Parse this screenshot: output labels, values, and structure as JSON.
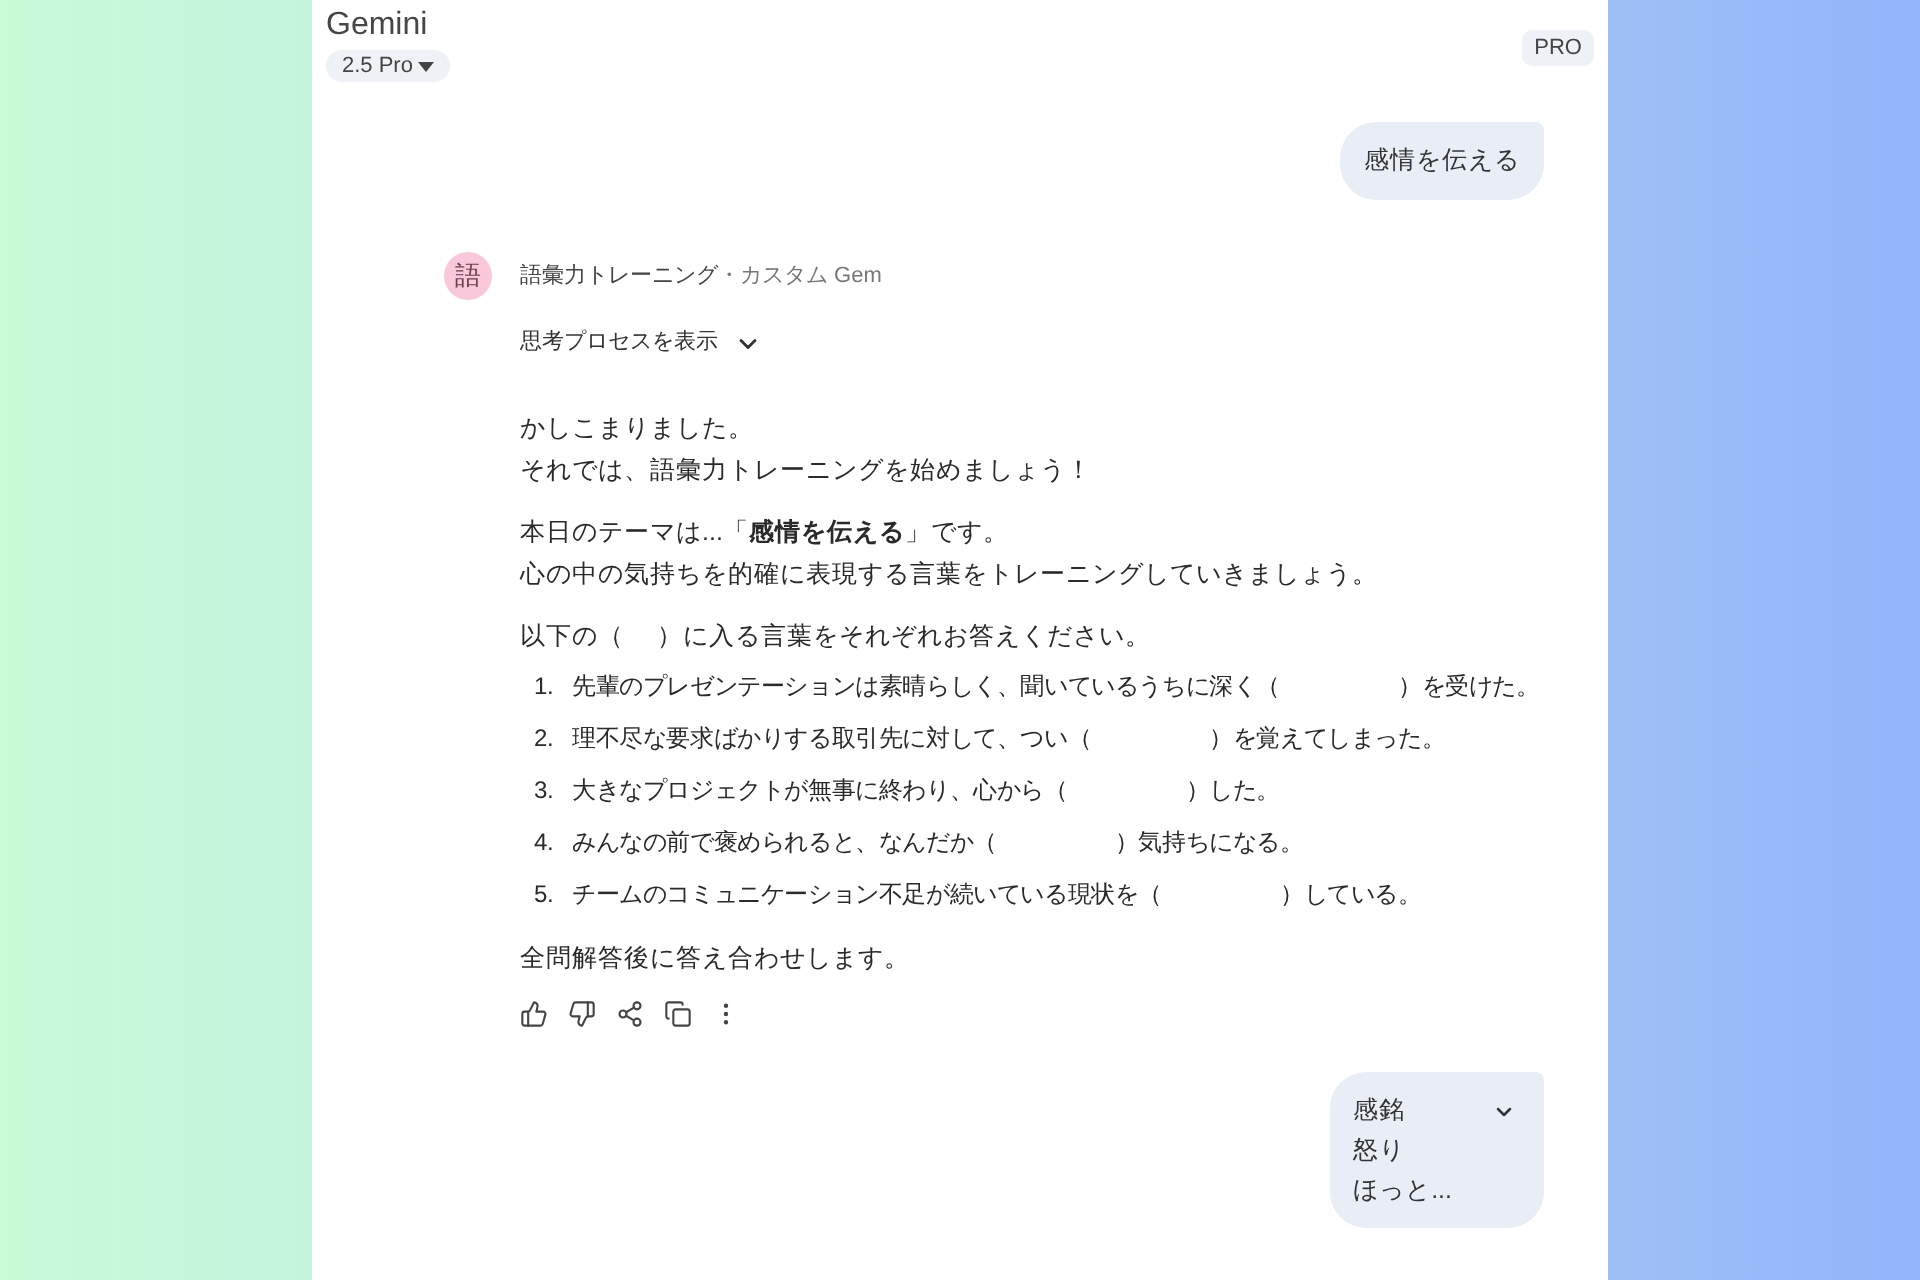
{
  "header": {
    "title": "Gemini",
    "model": "2.5 Pro",
    "badge": "PRO"
  },
  "user_message": {
    "text": "感情を伝える"
  },
  "response": {
    "avatar": "語",
    "gem_name": "語彙力トレーニング",
    "gem_kind": "・カスタム Gem",
    "thinking": {
      "label": "思考プロセスを表示",
      "expanded": false
    },
    "paragraphs": [
      [
        "かしこまりました。",
        "それでは、語彙力トレーニングを始めましょう！"
      ],
      [
        "本日のテーマは...「**感情を伝える**」です。",
        "心の中の気持ちを的確に表現する言葉をトレーニングしていきましょう。"
      ],
      [
        "以下の（　 ）に入る言葉をそれぞれお答えください。"
      ]
    ],
    "questions": [
      {
        "number": "1.",
        "text": "先輩のプレゼンテーションは素晴らしく、聞いているうちに深く（　　　　　）を受けた。"
      },
      {
        "number": "2.",
        "text": "理不尽な要求ばかりする取引先に対して、つい（　　　　　）を覚えてしまった。"
      },
      {
        "number": "3.",
        "text": "大きなプロジェクトが無事に終わり、心から（　　　　　）した。"
      },
      {
        "number": "4.",
        "text": "みんなの前で褒められると、なんだか（　　　　　）気持ちになる。"
      },
      {
        "number": "5.",
        "text": "チームのコミュニケーション不足が続いている現状を（　　　　　）している。"
      }
    ],
    "closing": "全問解答後に答え合わせします。"
  },
  "user_reply": {
    "lines": [
      "感銘",
      "怒り",
      "ほっと..."
    ],
    "expanded": false
  }
}
